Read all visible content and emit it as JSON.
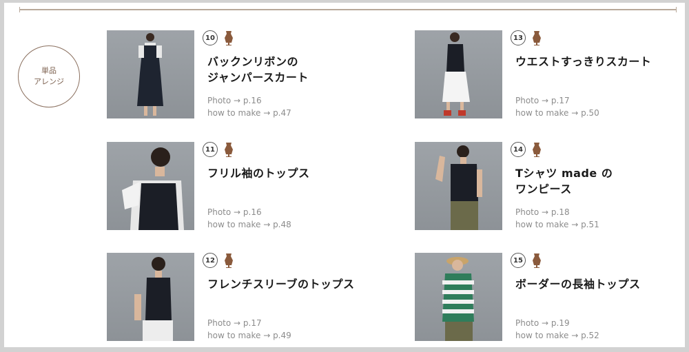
{
  "badge": {
    "line1": "単品",
    "line2": "アレンジ"
  },
  "items": [
    {
      "number": "10",
      "title_line1": "バックンリボンの",
      "title_line2": "ジャンパースカート",
      "photo_ref": "Photo → p.16",
      "howto_ref": "how to make → p.47"
    },
    {
      "number": "11",
      "title_line1": "フリル袖のトップス",
      "title_line2": "",
      "photo_ref": "Photo → p.16",
      "howto_ref": "how to make → p.48"
    },
    {
      "number": "12",
      "title_line1": "フレンチスリーブのトップス",
      "title_line2": "",
      "photo_ref": "Photo → p.17",
      "howto_ref": "how to make → p.49"
    },
    {
      "number": "13",
      "title_line1": "ウエストすっきりスカート",
      "title_line2": "",
      "photo_ref": "Photo → p.17",
      "howto_ref": "how to make → p.50"
    },
    {
      "number": "14",
      "title_line1": "Tシャツ made の",
      "title_line2": "ワンピース",
      "photo_ref": "Photo → p.18",
      "howto_ref": "how to make → p.51"
    },
    {
      "number": "15",
      "title_line1": "ボーダーの長袖トップス",
      "title_line2": "",
      "photo_ref": "Photo → p.19",
      "howto_ref": "how to make → p.52"
    }
  ],
  "colors": {
    "accent": "#8a5a3c",
    "badge_border": "#8a6f5e",
    "rule": "#b8a89a",
    "photo_bg": "#9ea3a8"
  },
  "icons": {
    "tag": "dress-form-icon"
  }
}
